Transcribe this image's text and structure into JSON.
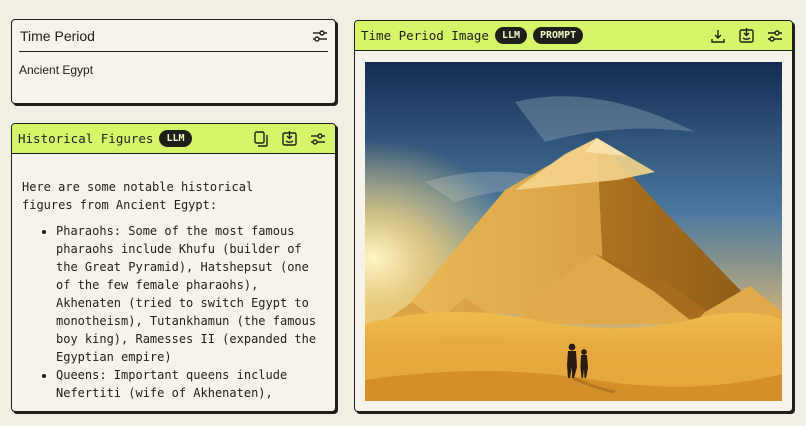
{
  "time_period_card": {
    "title": "Time Period",
    "value": "Ancient Egypt",
    "icons": [
      "sliders-icon"
    ]
  },
  "historical_figures_card": {
    "title": "Historical Figures",
    "badge": "LLM",
    "icons": [
      "copy-icon",
      "inbox-icon",
      "sliders-icon"
    ],
    "intro": "Here are some notable historical figures from Ancient Egypt:",
    "items": [
      "Pharaohs: Some of the most famous pharaohs include Khufu (builder of the Great Pyramid), Hatshepsut (one of the few female pharaohs), Akhenaten (tried to switch Egypt to monotheism), Tutankhamun (the famous boy king), Ramesses II (expanded the Egyptian empire)",
      "Queens: Important queens include Nefertiti (wife of Akhenaten),"
    ]
  },
  "image_card": {
    "title": "Time Period Image",
    "badges": [
      "LLM",
      "PROMPT"
    ],
    "icons": [
      "download-icon",
      "inbox-icon",
      "sliders-icon"
    ],
    "image": "pyramid-desert-illustration"
  },
  "colors": {
    "background": "#f1eee4",
    "accent": "#d6f66a",
    "ink": "#1f1f1a"
  }
}
